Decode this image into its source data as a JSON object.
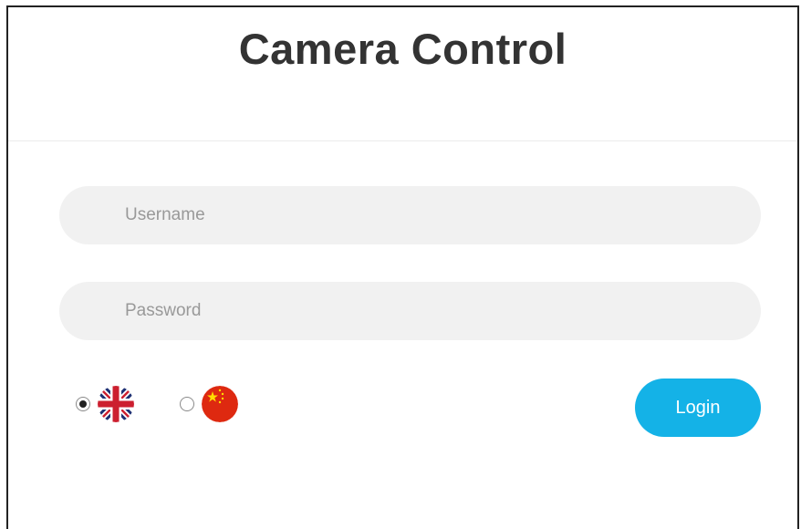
{
  "header": {
    "title": "Camera Control"
  },
  "form": {
    "username_placeholder": "Username",
    "username_value": "",
    "password_placeholder": "Password",
    "password_value": "",
    "login_label": "Login"
  },
  "language": {
    "options": [
      {
        "id": "en",
        "icon": "uk-flag-icon",
        "selected": true
      },
      {
        "id": "zh",
        "icon": "china-flag-icon",
        "selected": false
      }
    ],
    "selected": "en"
  },
  "colors": {
    "accent": "#14b2e7",
    "input_bg": "#f1f1f1",
    "title": "#333333"
  }
}
